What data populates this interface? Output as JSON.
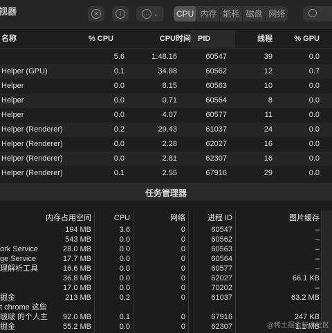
{
  "activity_monitor": {
    "title": "视器",
    "tabs": [
      "CPU",
      "内存",
      "能耗",
      "磁盘",
      "网络"
    ],
    "active_tab": "CPU",
    "columns": [
      "名称",
      "% CPU",
      "CPU时间",
      "PID",
      "线程",
      "% GPU"
    ],
    "rows": [
      {
        "name": "",
        "cpu": "5.6",
        "cpu_time": "1:48.16",
        "pid": "60547",
        "threads": "39",
        "gpu": "0.0"
      },
      {
        "name": "Helper (GPU)",
        "cpu": "0.1",
        "cpu_time": "34.88",
        "pid": "60562",
        "threads": "12",
        "gpu": "0.7"
      },
      {
        "name": "Helper",
        "cpu": "0.0",
        "cpu_time": "8.15",
        "pid": "60563",
        "threads": "10",
        "gpu": "0.0"
      },
      {
        "name": "Helper",
        "cpu": "0.0",
        "cpu_time": "0.71",
        "pid": "60564",
        "threads": "8",
        "gpu": "0.0"
      },
      {
        "name": "Helper",
        "cpu": "0.0",
        "cpu_time": "4.07",
        "pid": "60577",
        "threads": "11",
        "gpu": "0.0"
      },
      {
        "name": "Helper (Renderer)",
        "cpu": "0.2",
        "cpu_time": "29.43",
        "pid": "61037",
        "threads": "24",
        "gpu": "0.0"
      },
      {
        "name": "Helper (Renderer)",
        "cpu": "0.0",
        "cpu_time": "2.28",
        "pid": "62027",
        "threads": "16",
        "gpu": "0.0"
      },
      {
        "name": "Helper (Renderer)",
        "cpu": "0.0",
        "cpu_time": "2.81",
        "pid": "62307",
        "threads": "16",
        "gpu": "0.0"
      },
      {
        "name": "Helper (Renderer)",
        "cpu": "0.1",
        "cpu_time": "2.55",
        "pid": "67916",
        "threads": "29",
        "gpu": "0.0"
      }
    ]
  },
  "task_manager": {
    "title": "任务管理器",
    "columns": [
      "内存占用空间",
      "CPU",
      "网络",
      "进程 ID",
      "图片缓存"
    ],
    "rows": [
      {
        "name": "",
        "memory": "194 MB",
        "cpu": "3.6",
        "network": "0",
        "pid": "60547",
        "image_cache": "–"
      },
      {
        "name": "",
        "memory": "543 MB",
        "cpu": "0.0",
        "network": "0",
        "pid": "60562",
        "image_cache": "–"
      },
      {
        "name": "ork Service",
        "memory": "28.0 MB",
        "cpu": "0.0",
        "network": "0",
        "pid": "60563",
        "image_cache": "–"
      },
      {
        "name": "ge Service",
        "memory": "17.7 MB",
        "cpu": "0.0",
        "network": "0",
        "pid": "60564",
        "image_cache": "–"
      },
      {
        "name": "理解析工具",
        "memory": "16.6 MB",
        "cpu": "0.0",
        "network": "0",
        "pid": "60577",
        "image_cache": "–"
      },
      {
        "name": "",
        "memory": "36.8 MB",
        "cpu": "0.0",
        "network": "0",
        "pid": "62027",
        "image_cache": "66.1 KB"
      },
      {
        "name": "",
        "memory": "17.0 MB",
        "cpu": "0.0",
        "network": "0",
        "pid": "70202",
        "image_cache": "–"
      },
      {
        "name": "掘金",
        "memory": "213 MB",
        "cpu": "0.2",
        "network": "0",
        "pid": "61037",
        "image_cache": "63.2 MB"
      },
      {
        "name": "t chrome 这些",
        "memory": "",
        "cpu": "",
        "network": "",
        "pid": "",
        "image_cache": ""
      },
      {
        "name": "啵啵 的个人主",
        "memory": "92.0 MB",
        "cpu": "0.1",
        "network": "0",
        "pid": "67916",
        "image_cache": "247 KB"
      },
      {
        "name": "掘金",
        "memory": "55.2 MB",
        "cpu": "0.0",
        "network": "0",
        "pid": "62307",
        "image_cache": "1.1 MB"
      }
    ]
  },
  "watermark": "@稀土掘金技术社区"
}
